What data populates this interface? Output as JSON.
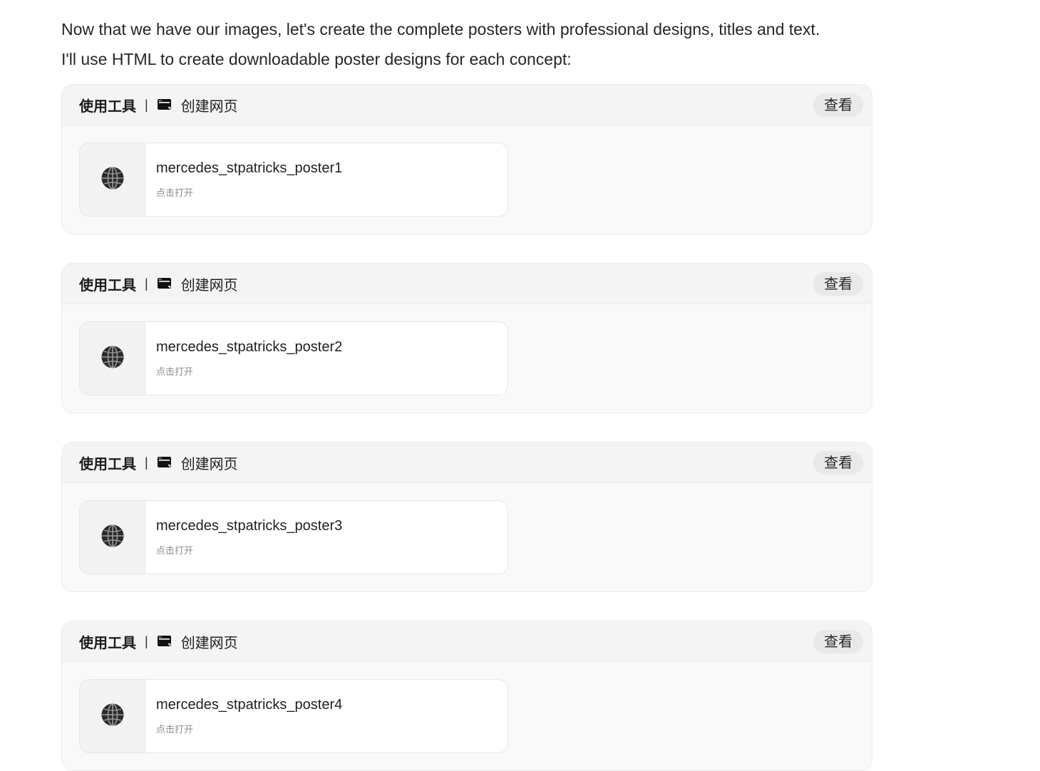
{
  "intro": {
    "line1": "Now that we have our images, let's create the complete posters with professional designs, titles and text.",
    "line2": "I'll use HTML to create downloadable poster designs for each concept:"
  },
  "tool_cards": [
    {
      "tool_label": "使用工具",
      "separator": "|",
      "tool_icon": "webpage-window-icon",
      "tool_name": "创建网页",
      "view_label": "查看",
      "file": {
        "icon": "globe-icon",
        "name": "mercedes_stpatricks_poster1",
        "hint": "点击打开"
      }
    },
    {
      "tool_label": "使用工具",
      "separator": "|",
      "tool_icon": "webpage-window-icon",
      "tool_name": "创建网页",
      "view_label": "查看",
      "file": {
        "icon": "globe-icon",
        "name": "mercedes_stpatricks_poster2",
        "hint": "点击打开"
      }
    },
    {
      "tool_label": "使用工具",
      "separator": "|",
      "tool_icon": "webpage-window-icon",
      "tool_name": "创建网页",
      "view_label": "查看",
      "file": {
        "icon": "globe-icon",
        "name": "mercedes_stpatricks_poster3",
        "hint": "点击打开"
      }
    },
    {
      "tool_label": "使用工具",
      "separator": "|",
      "tool_icon": "webpage-window-icon",
      "tool_name": "创建网页",
      "view_label": "查看",
      "file": {
        "icon": "globe-icon",
        "name": "mercedes_stpatricks_poster4",
        "hint": "点击打开"
      }
    }
  ],
  "colors": {
    "card_background": "#f9f9f9",
    "header_background": "#f4f4f4",
    "view_button_background": "#e9e9e9",
    "hint_text": "#8c8c8c"
  }
}
